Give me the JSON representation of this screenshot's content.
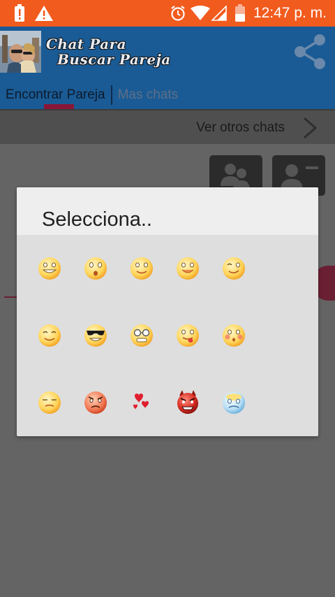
{
  "status_bar": {
    "time": "12:47 p. m.",
    "icons": [
      "battery-alert-icon",
      "warning-icon",
      "alarm-icon",
      "wifi-icon",
      "signal-icon",
      "battery-icon"
    ],
    "background_color": "#f25b1e"
  },
  "app_bar": {
    "title_line1": "Chat Para",
    "title_line2": "Buscar Pareja",
    "share_icon": "share-icon",
    "background_color": "#1a5b95"
  },
  "tabs": [
    {
      "label": "Encontrar Pareja",
      "active": true
    },
    {
      "label": "Mas chats",
      "active": false
    }
  ],
  "sub_bar": {
    "label": "Ver otros chats",
    "icon": "chevron-right-icon"
  },
  "dialog": {
    "title": "Selecciona..",
    "emojis": [
      [
        "grin-emoji",
        "surprised-emoji",
        "smile-emoji",
        "happy-emoji",
        "wink-emoji"
      ],
      [
        "content-emoji",
        "sunglasses-emoji",
        "nerd-emoji",
        "tongue-emoji",
        "blush-emoji"
      ],
      [
        "sleepy-emoji",
        "angry-emoji",
        "hearts-emoji",
        "devil-emoji",
        "frozen-emoji"
      ]
    ]
  }
}
